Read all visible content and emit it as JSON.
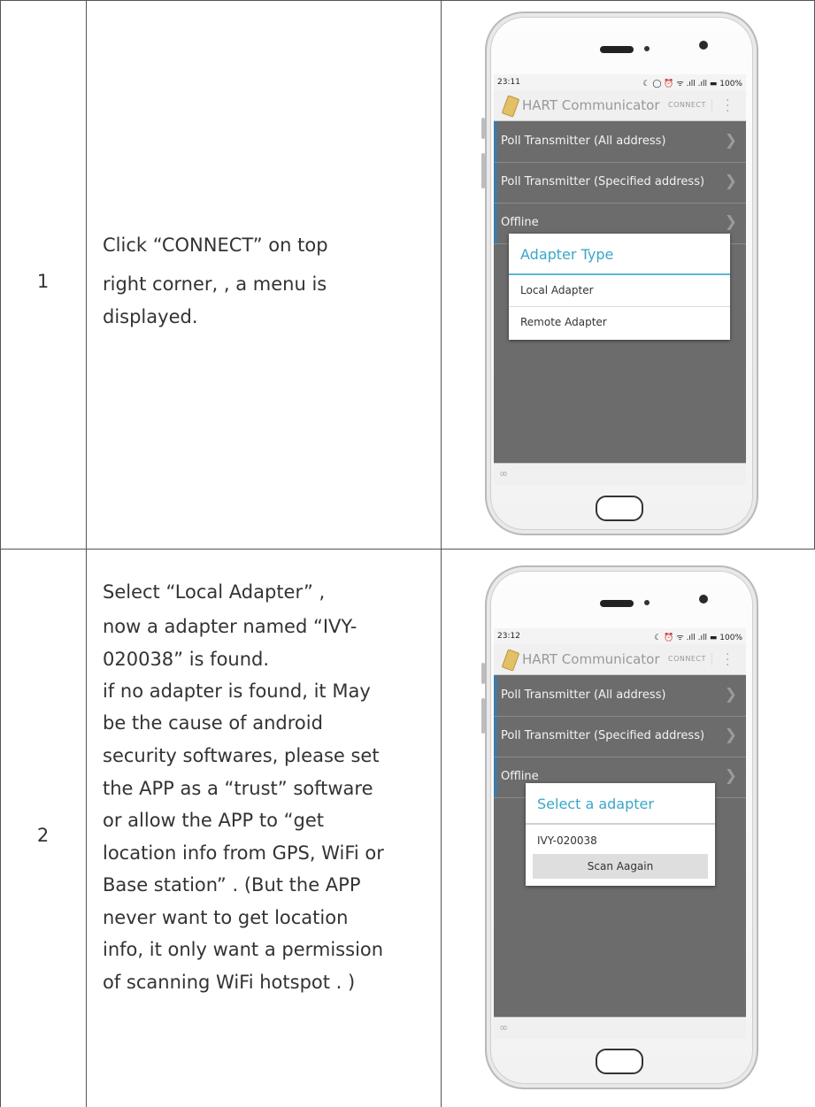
{
  "steps": [
    {
      "number": "1",
      "description": [
        "Click “CONNECT” on top",
        "right corner, , a menu is",
        "displayed."
      ],
      "phone": {
        "time": "23:11",
        "status_icons": "☾ ◯ ⏰ ᯤ .ıll .ıll ▬ 100%",
        "app_title": "HART Communicator",
        "connect_label": "CONNECT",
        "menu_items": [
          "Poll Transmitter (All address)",
          "Poll Transmitter (Specified address)",
          "Offline"
        ],
        "dialog": {
          "title": "Adapter Type",
          "items": [
            "Local Adapter",
            "Remote Adapter"
          ]
        }
      }
    },
    {
      "number": "2",
      "description": [
        "Select “Local Adapter” ,",
        "now a adapter named “IVY-",
        "020038” is found.",
        "if no adapter is found, it May",
        "be the cause of android",
        "security softwares, please set",
        "the APP as a “trust” software",
        "or allow the APP to “get",
        "location info from GPS, WiFi or",
        "Base station” . (But the APP",
        "never want to get location",
        "info, it only want a permission",
        "of scanning WiFi hotspot . )"
      ],
      "phone": {
        "time": "23:12",
        "status_icons": "☾ ⏰ ᯤ .ıll .ıll ▬ 100%",
        "app_title": "HART Communicator",
        "connect_label": "CONNECT",
        "menu_items": [
          "Poll Transmitter (All address)",
          "Poll Transmitter (Specified address)",
          "Offline"
        ],
        "dialog": {
          "title": "Select a adapter",
          "items": [
            "IVY-020038"
          ],
          "button": "Scan Aagain"
        }
      }
    }
  ],
  "icons": {
    "chevron": "chevron-right-icon",
    "overflow": "more-vert-icon",
    "link": "link-icon",
    "app": "hart-communicator-icon"
  },
  "colors": {
    "accent": "#3aa6c8",
    "menu_background": "#6c6c6c",
    "border": "#555555"
  }
}
